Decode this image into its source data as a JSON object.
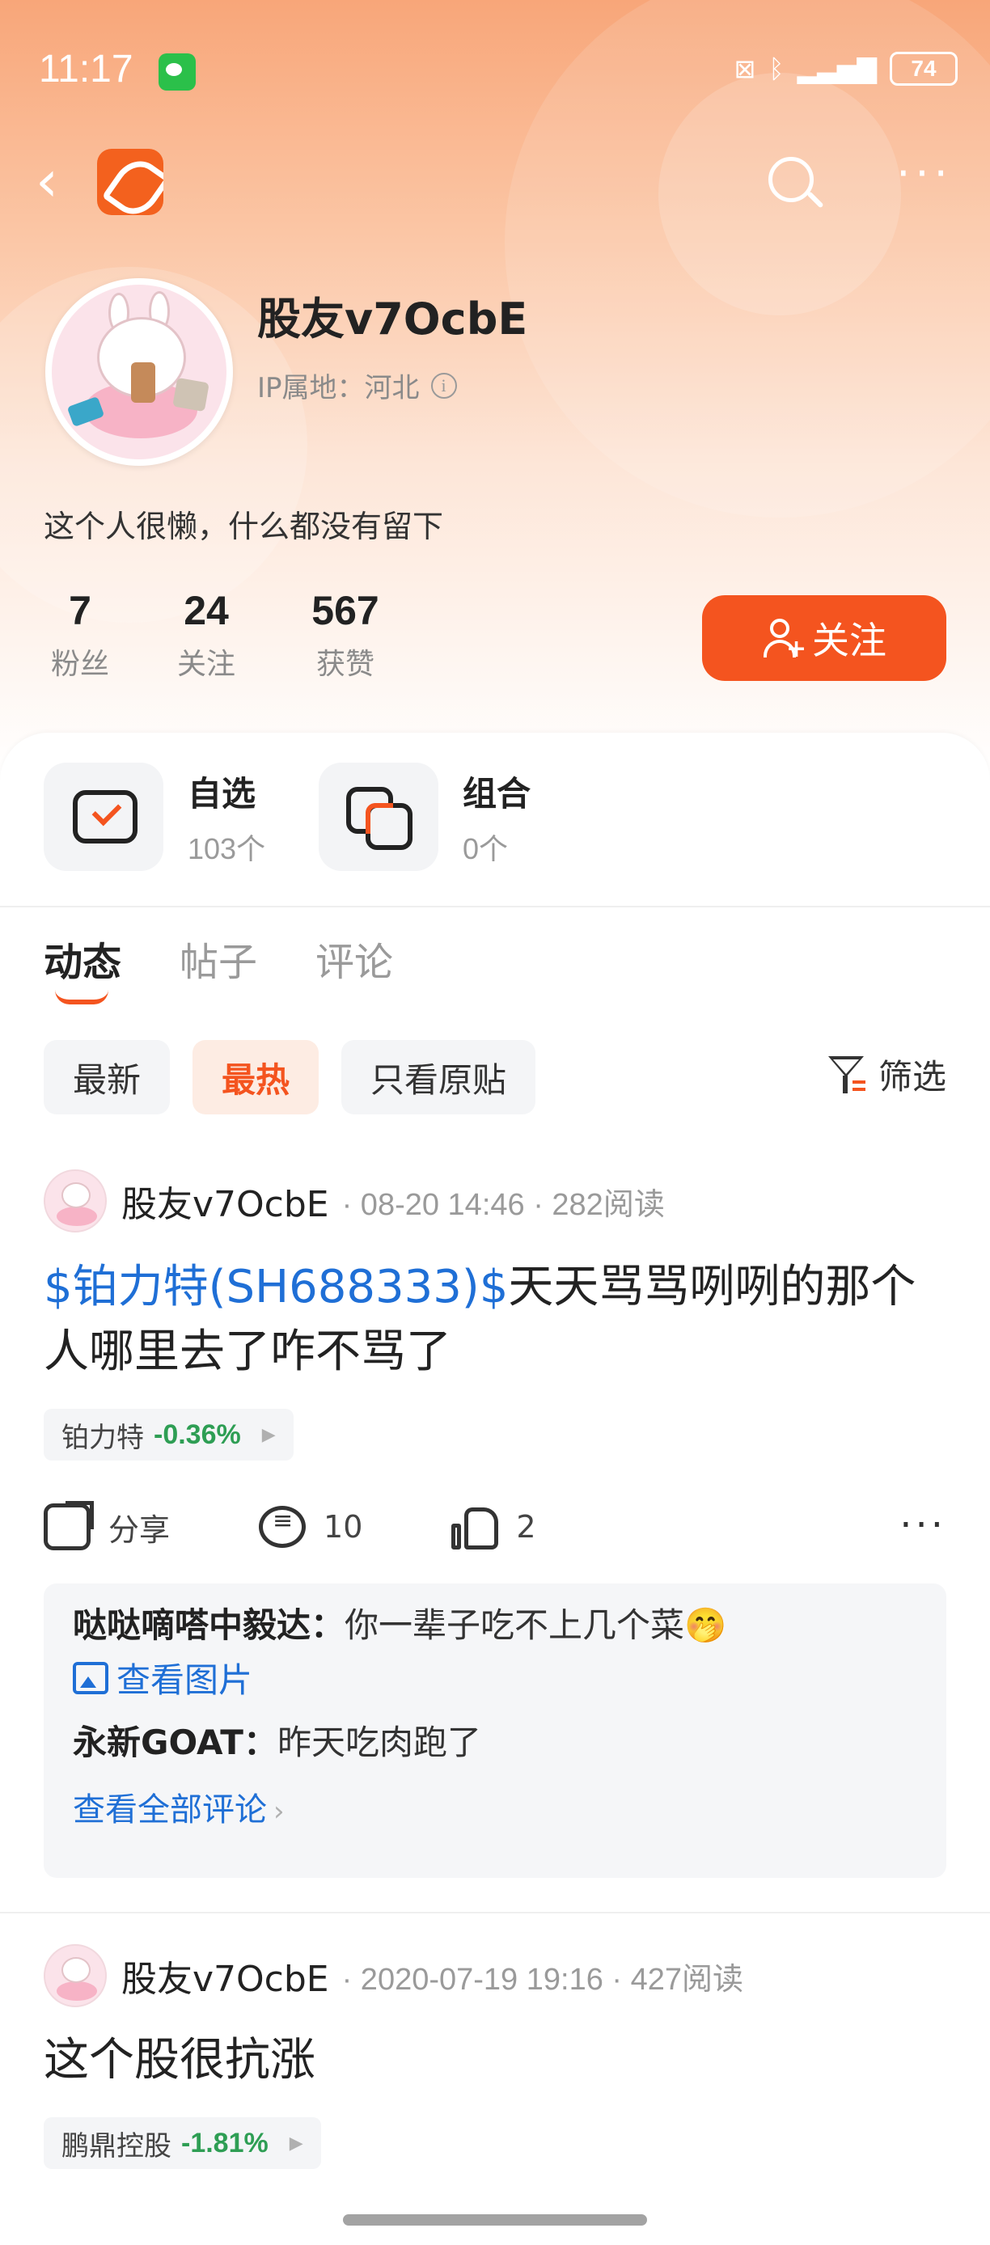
{
  "status_bar": {
    "time": "11:17",
    "battery": "74"
  },
  "profile": {
    "username": "股友v7OcbE",
    "ip_label": "IP属地：河北",
    "bio": "这个人很懒，什么都没有留下",
    "stats": [
      {
        "num": "7",
        "label": "粉丝"
      },
      {
        "num": "24",
        "label": "关注"
      },
      {
        "num": "567",
        "label": "获赞"
      }
    ],
    "follow_label": "关注"
  },
  "assets": [
    {
      "title": "自选",
      "sub": "103个"
    },
    {
      "title": "组合",
      "sub": "0个"
    }
  ],
  "tabs": [
    "动态",
    "帖子",
    "评论"
  ],
  "filters": [
    "最新",
    "最热",
    "只看原贴"
  ],
  "filter_button": "筛选",
  "posts": [
    {
      "author": "股友v7OcbE",
      "meta": "· 08-20 14:46 · 282阅读",
      "stock_link": "$铂力特(SH688333)$",
      "text": "天天骂骂咧咧的那个人哪里去了咋不骂了",
      "tag_name": "铂力特",
      "tag_change": "-0.36%",
      "share_label": "分享",
      "comment_count": "10",
      "like_count": "2",
      "comments": [
        {
          "name": "哒哒嘀嗒中毅达：",
          "text": "你一辈子吃不上几个菜🤭"
        },
        {
          "name": "永新GOAT：",
          "text": "昨天吃肉跑了"
        }
      ],
      "view_image": "查看图片",
      "view_all": "查看全部评论"
    },
    {
      "author": "股友v7OcbE",
      "meta": "· 2020-07-19 19:16 · 427阅读",
      "text": "这个股很抗涨",
      "tag_name": "鹏鼎控股",
      "tag_change": "-1.81%"
    }
  ]
}
